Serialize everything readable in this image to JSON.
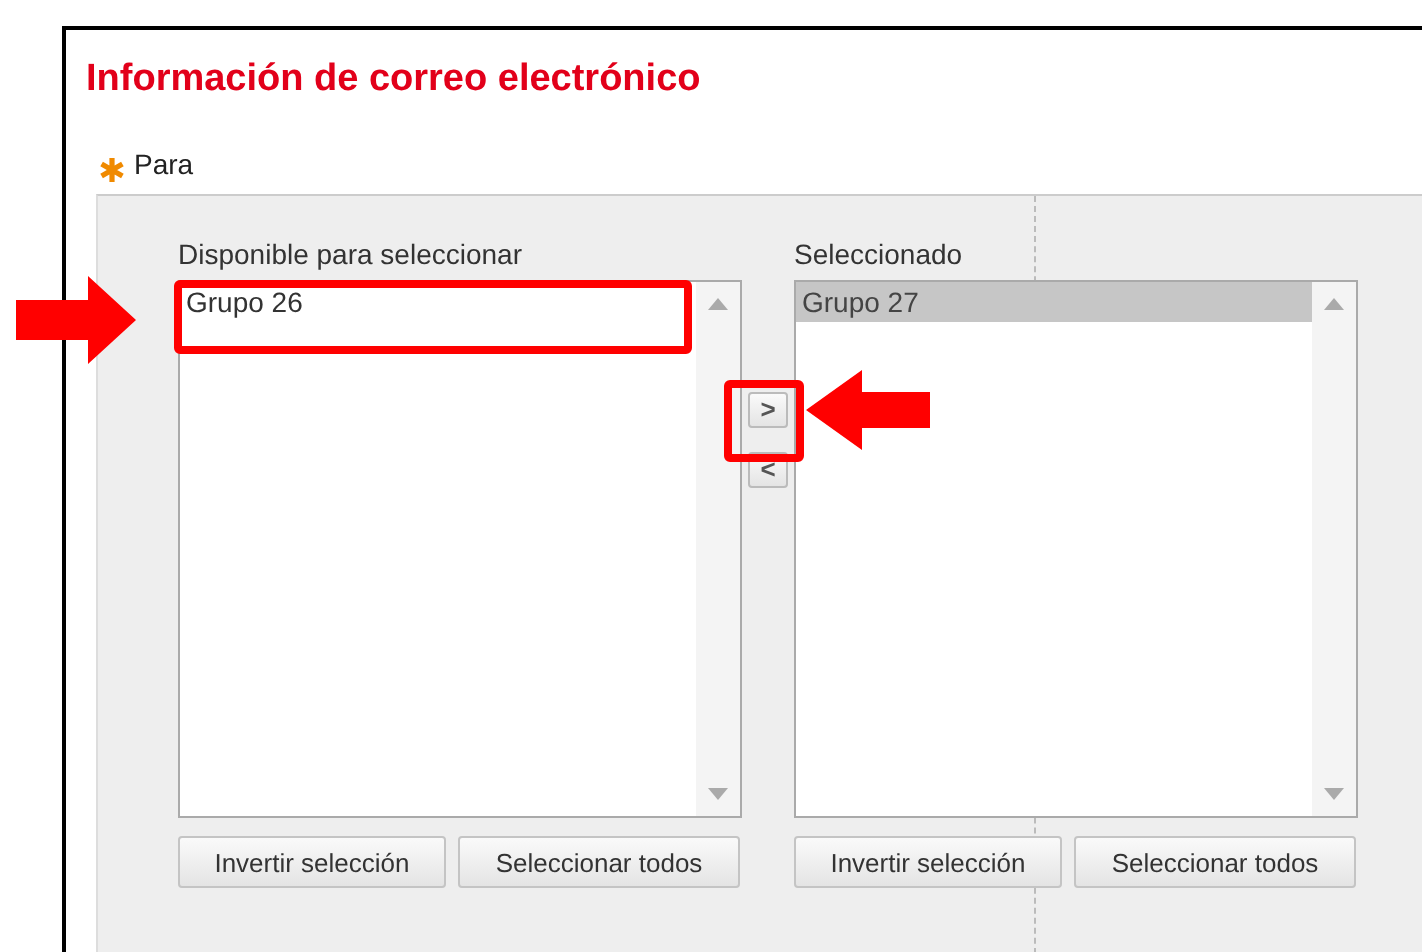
{
  "section": {
    "title": "Información de correo electrónico"
  },
  "field": {
    "label": "Para",
    "required": true
  },
  "available": {
    "label": "Disponible para seleccionar",
    "items": [
      {
        "text": "Grupo 26",
        "selected": false
      }
    ],
    "buttons": [
      "Invertir selección",
      "Seleccionar todos"
    ]
  },
  "move_buttons": [
    ">",
    "<"
  ],
  "chosen": {
    "label": "Seleccionado",
    "items": [
      {
        "text": "Grupo 27",
        "selected": true
      }
    ],
    "buttons": [
      "Invertir selección",
      "Seleccionar todos"
    ]
  }
}
